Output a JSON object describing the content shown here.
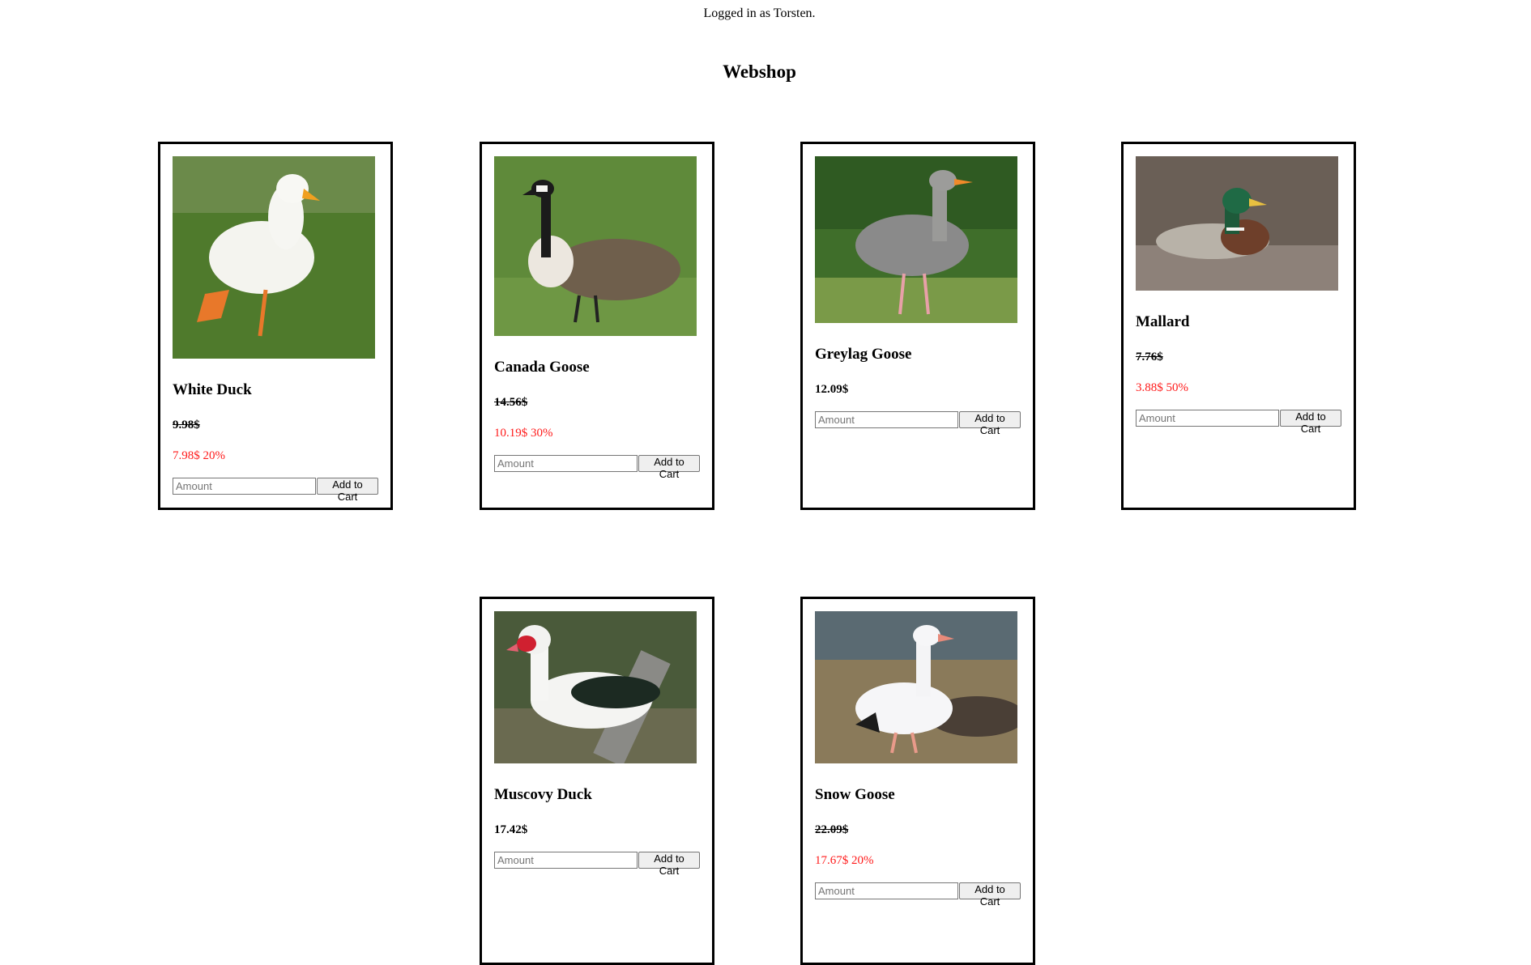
{
  "header": {
    "login_text": "Logged in as Torsten.",
    "title": "Webshop"
  },
  "products": [
    {
      "name": "White Duck",
      "old_price": "9.98$",
      "sale_price": "7.98$ 20%",
      "amount_placeholder": "Amount",
      "button_label": "Add to Cart"
    },
    {
      "name": "Canada Goose",
      "old_price": "14.56$",
      "sale_price": "10.19$ 30%",
      "amount_placeholder": "Amount",
      "button_label": "Add to Cart"
    },
    {
      "name": "Greylag Goose",
      "price": "12.09$",
      "amount_placeholder": "Amount",
      "button_label": "Add to Cart"
    },
    {
      "name": "Mallard",
      "old_price": "7.76$",
      "sale_price": "3.88$ 50%",
      "amount_placeholder": "Amount",
      "button_label": "Add to Cart"
    },
    {
      "name": "Muscovy Duck",
      "price": "17.42$",
      "amount_placeholder": "Amount",
      "button_label": "Add to Cart"
    },
    {
      "name": "Snow Goose",
      "old_price": "22.09$",
      "sale_price": "17.67$ 20%",
      "amount_placeholder": "Amount",
      "button_label": "Add to Cart"
    }
  ],
  "colors": {
    "sale_price": "#ff1a1a",
    "border": "#000000"
  }
}
